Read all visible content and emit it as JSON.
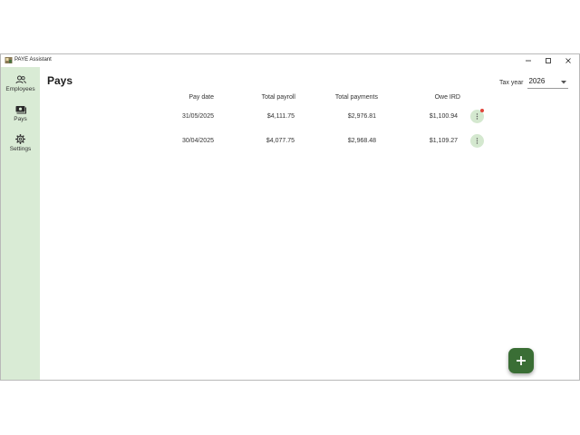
{
  "window": {
    "title": "PAYE Assistant"
  },
  "nav": {
    "items": [
      {
        "label": "Employees",
        "icon": "people-icon"
      },
      {
        "label": "Pays",
        "icon": "money-icon"
      },
      {
        "label": "Settings",
        "icon": "gear-icon"
      }
    ]
  },
  "page": {
    "title": "Pays"
  },
  "tax_year": {
    "label": "Tax year",
    "value": "2026"
  },
  "table": {
    "columns": [
      "Pay date",
      "Total payroll",
      "Total payments",
      "Owe IRD"
    ],
    "rows": [
      {
        "pay_date": "31/05/2025",
        "total_payroll": "$4,111.75",
        "total_payments": "$2,976.81",
        "owe_ird": "$1,100.94",
        "has_notification": true
      },
      {
        "pay_date": "30/04/2025",
        "total_payroll": "$4,077.75",
        "total_payments": "$2,968.48",
        "owe_ird": "$1,109.27",
        "has_notification": false
      }
    ]
  },
  "colors": {
    "rail_background": "#d9ebd5",
    "accent": "#3a6e35",
    "menu_button": "#d4e8cf",
    "notification": "#e0453a"
  }
}
